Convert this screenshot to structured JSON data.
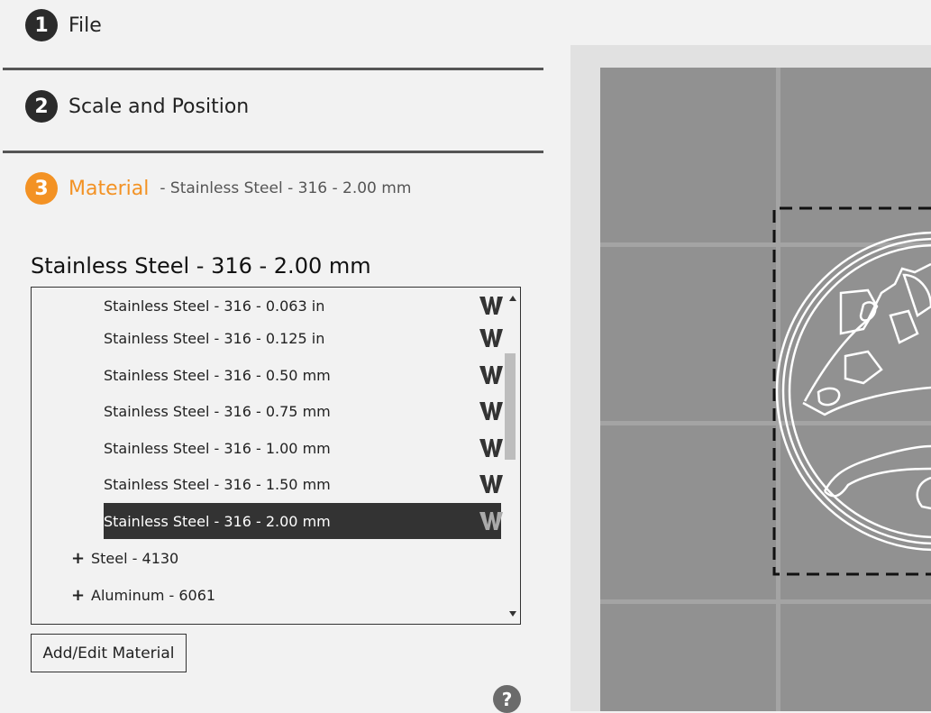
{
  "steps": [
    {
      "number": "1",
      "label": "File"
    },
    {
      "number": "2",
      "label": "Scale and Position"
    },
    {
      "number": "3",
      "label": "Material",
      "subtitle": "- Stainless Steel - 316 - 2.00 mm"
    }
  ],
  "material": {
    "selected_title": "Stainless Steel - 316 - 2.00 mm",
    "items": [
      {
        "label": "Stainless Steel - 316 - 0.063 in",
        "icon": "w-icon"
      },
      {
        "label": "Stainless Steel - 316 - 0.125 in",
        "icon": "w-icon"
      },
      {
        "label": "Stainless Steel - 316 - 0.50 mm",
        "icon": "w-icon"
      },
      {
        "label": "Stainless Steel - 316 - 0.75 mm",
        "icon": "w-icon"
      },
      {
        "label": "Stainless Steel - 316 - 1.00 mm",
        "icon": "w-icon"
      },
      {
        "label": "Stainless Steel - 316 - 1.50 mm",
        "icon": "w-icon"
      },
      {
        "label": "Stainless Steel - 316 - 2.00 mm",
        "icon": "w-icon",
        "selected": true
      }
    ],
    "groups": [
      {
        "label": "Steel - 4130",
        "icon": "plus-icon"
      },
      {
        "label": "Aluminum - 6061",
        "icon": "plus-icon"
      }
    ],
    "add_edit_label": "Add/Edit Material",
    "help_label": "?"
  },
  "colors": {
    "accent": "#f39224",
    "step_circle": "#2b2b2b",
    "selected_row": "#333333",
    "canvas_bg": "#919191",
    "canvas_grid": "#a4a4a4"
  }
}
